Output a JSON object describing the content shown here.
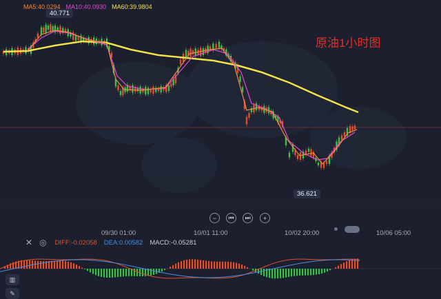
{
  "legend": {
    "ma5": "MA5:40.0294",
    "ma10": "MA10:40.0930",
    "ma60": "MA60:39.9804"
  },
  "chart_title": "原油1小时图",
  "price_high": "40.771",
  "price_low": "36.621",
  "x_ticks": [
    "09/30 01:00",
    "10/01 11:00",
    "10/02 20:00",
    "10/06 05:00"
  ],
  "macd": {
    "diff": "DIFF:-0.02058",
    "dea": "DEA:0.00582",
    "macd": "MACD:-0.05281"
  },
  "controls": {
    "zoom_out": "−",
    "prev": "⏮",
    "next": "⏭",
    "zoom_in": "+"
  },
  "colors": {
    "background": "#1b1f2e",
    "up": "#e0502c",
    "down": "#3fbf4a",
    "ma5": "#f28a3c",
    "ma10": "#e04ad1",
    "ma60": "#f2e24a",
    "title": "#e0302c"
  }
}
